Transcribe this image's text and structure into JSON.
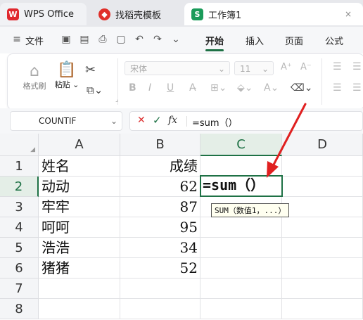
{
  "tabs": [
    {
      "label": "WPS Office",
      "icon": "wps-logo-icon"
    },
    {
      "label": "找稻壳模板",
      "icon": "docer-icon"
    },
    {
      "label": "工作簿1",
      "icon": "spreadsheet-icon",
      "icon_letter": "S",
      "close": "×"
    }
  ],
  "menubar": {
    "file": "文件",
    "tabs": [
      "开始",
      "插入",
      "页面",
      "公式"
    ],
    "active_tab": "开始"
  },
  "ribbon": {
    "format_painter": "格式刷",
    "paste": "粘贴",
    "font_name": "宋体",
    "font_size": "11"
  },
  "formula_bar": {
    "name_box": "COUNTIF",
    "fx": "fx",
    "content": "=sum（）"
  },
  "columns": [
    "A",
    "B",
    "C",
    "D"
  ],
  "rows": [
    {
      "num": "1",
      "a": "姓名",
      "b": "成绩"
    },
    {
      "num": "2",
      "a": "动动",
      "b": "62"
    },
    {
      "num": "3",
      "a": "牢牢",
      "b": "87"
    },
    {
      "num": "4",
      "a": "呵呵",
      "b": "95"
    },
    {
      "num": "5",
      "a": "浩浩",
      "b": "34"
    },
    {
      "num": "6",
      "a": "猪猪",
      "b": "52"
    },
    {
      "num": "7",
      "a": "",
      "b": ""
    },
    {
      "num": "8",
      "a": "",
      "b": ""
    }
  ],
  "active_cell": {
    "ref": "C2",
    "content": "=sum（）"
  },
  "tooltip": "SUM（数值1，...）",
  "colors": {
    "accent": "#1e7145",
    "arrow": "#e02020",
    "wps_red": "#e0282e",
    "sheet_green": "#1a9b5a"
  }
}
